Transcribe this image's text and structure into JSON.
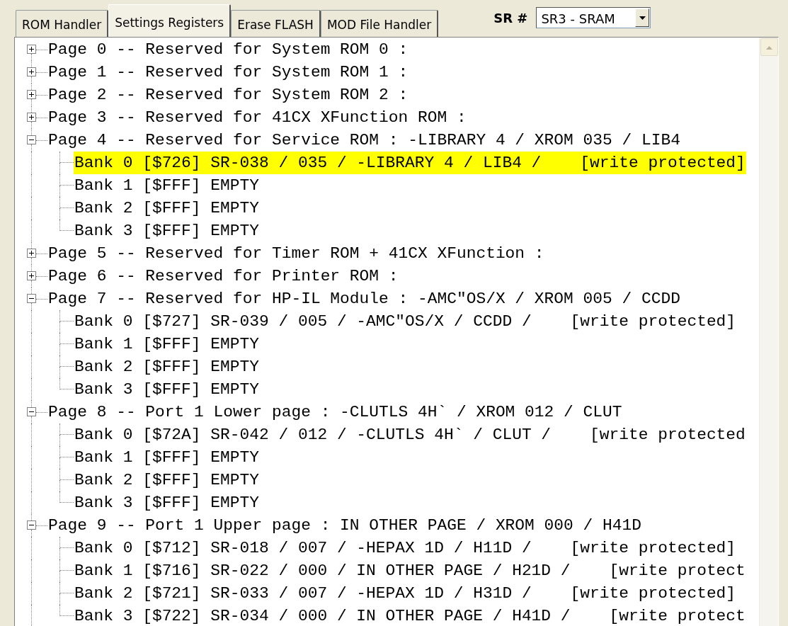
{
  "tabs": [
    {
      "label": "ROM Handler",
      "selected": false
    },
    {
      "label": "Settings Registers",
      "selected": true
    },
    {
      "label": "Erase FLASH",
      "selected": false
    },
    {
      "label": "MOD File Handler",
      "selected": false
    }
  ],
  "sr_label": "SR #",
  "sr_select": {
    "value": "SR3 - SRAM"
  },
  "tree": [
    {
      "label": "Page 0 -- Reserved for System ROM 0 :",
      "expanded": false
    },
    {
      "label": "Page 1 -- Reserved for System ROM 1 :",
      "expanded": false
    },
    {
      "label": "Page 2 -- Reserved for System ROM 2 :",
      "expanded": false
    },
    {
      "label": "Page 3 -- Reserved for 41CX XFunction ROM :",
      "expanded": false
    },
    {
      "label": "Page 4 -- Reserved for Service ROM : -LIBRARY 4 / XROM 035 / LIB4",
      "expanded": true,
      "children": [
        {
          "label": "Bank 0 [$726] SR-038 / 035 / -LIBRARY 4 / LIB4 /    [write protected]",
          "selected": true
        },
        {
          "label": "Bank 1 [$FFF] EMPTY",
          "selected": false
        },
        {
          "label": "Bank 2 [$FFF] EMPTY",
          "selected": false
        },
        {
          "label": "Bank 3 [$FFF] EMPTY",
          "selected": false
        }
      ]
    },
    {
      "label": "Page 5 -- Reserved for Timer ROM + 41CX XFunction :",
      "expanded": false
    },
    {
      "label": "Page 6 -- Reserved for Printer ROM :",
      "expanded": false
    },
    {
      "label": "Page 7 -- Reserved for HP-IL Module : -AMC\"OS/X / XROM 005 / CCDD",
      "expanded": true,
      "children": [
        {
          "label": "Bank 0 [$727] SR-039 / 005 / -AMC\"OS/X / CCDD /    [write protected]",
          "selected": false
        },
        {
          "label": "Bank 1 [$FFF] EMPTY",
          "selected": false
        },
        {
          "label": "Bank 2 [$FFF] EMPTY",
          "selected": false
        },
        {
          "label": "Bank 3 [$FFF] EMPTY",
          "selected": false
        }
      ]
    },
    {
      "label": "Page 8 -- Port 1 Lower page : -CLUTLS 4H` / XROM 012 / CLUT",
      "expanded": true,
      "children": [
        {
          "label": "Bank 0 [$72A] SR-042 / 012 / -CLUTLS 4H` / CLUT /    [write protected",
          "selected": false
        },
        {
          "label": "Bank 1 [$FFF] EMPTY",
          "selected": false
        },
        {
          "label": "Bank 2 [$FFF] EMPTY",
          "selected": false
        },
        {
          "label": "Bank 3 [$FFF] EMPTY",
          "selected": false
        }
      ]
    },
    {
      "label": "Page 9 -- Port 1 Upper page : IN OTHER PAGE / XROM 000 / H41D",
      "expanded": true,
      "children": [
        {
          "label": "Bank 0 [$712] SR-018 / 007 / -HEPAX 1D / H11D /    [write protected]",
          "selected": false
        },
        {
          "label": "Bank 1 [$716] SR-022 / 000 / IN OTHER PAGE / H21D /    [write protect",
          "selected": false
        },
        {
          "label": "Bank 2 [$721] SR-033 / 007 / -HEPAX 1D / H31D /    [write protected]",
          "selected": false
        },
        {
          "label": "Bank 3 [$722] SR-034 / 000 / IN OTHER PAGE / H41D /    [write protect",
          "selected": false
        }
      ]
    }
  ]
}
